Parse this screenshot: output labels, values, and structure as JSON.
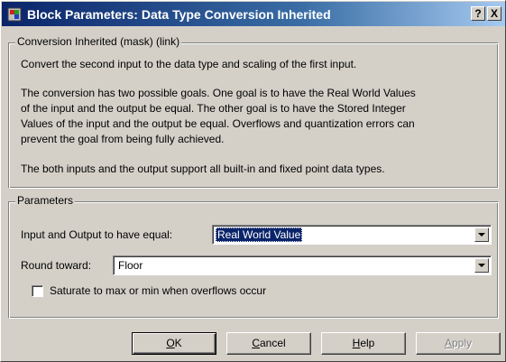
{
  "window": {
    "title": "Block Parameters: Data Type Conversion Inherited",
    "help_btn": "?",
    "close_btn": "X"
  },
  "description": {
    "legend": "Conversion Inherited (mask) (link)",
    "lines": [
      "Convert the second input to the data type and scaling of the first input.",
      "The conversion has two possible goals.  One goal is to have the Real World Values",
      "of the input and the output be equal.  The other goal is to have the Stored Integer",
      "Values of the input and the output be equal.  Overflows and quantization errors can",
      "prevent the goal from being fully achieved.",
      "The both inputs and the output support all built-in and fixed point data types."
    ]
  },
  "parameters": {
    "legend": "Parameters",
    "equal_label": "Input and Output to have equal:",
    "equal_value": "Real World Value",
    "round_label": "Round toward:",
    "round_value": "Floor",
    "saturate_label": "Saturate to max or min when overflows occur",
    "saturate_checked": false
  },
  "buttons": {
    "ok": "OK",
    "cancel": "Cancel",
    "help": "Help",
    "apply": "Apply"
  },
  "colors": {
    "face": "#d4d0c8",
    "title_start": "#0a246a",
    "title_end": "#a6caf0",
    "selection": "#0a246a"
  }
}
